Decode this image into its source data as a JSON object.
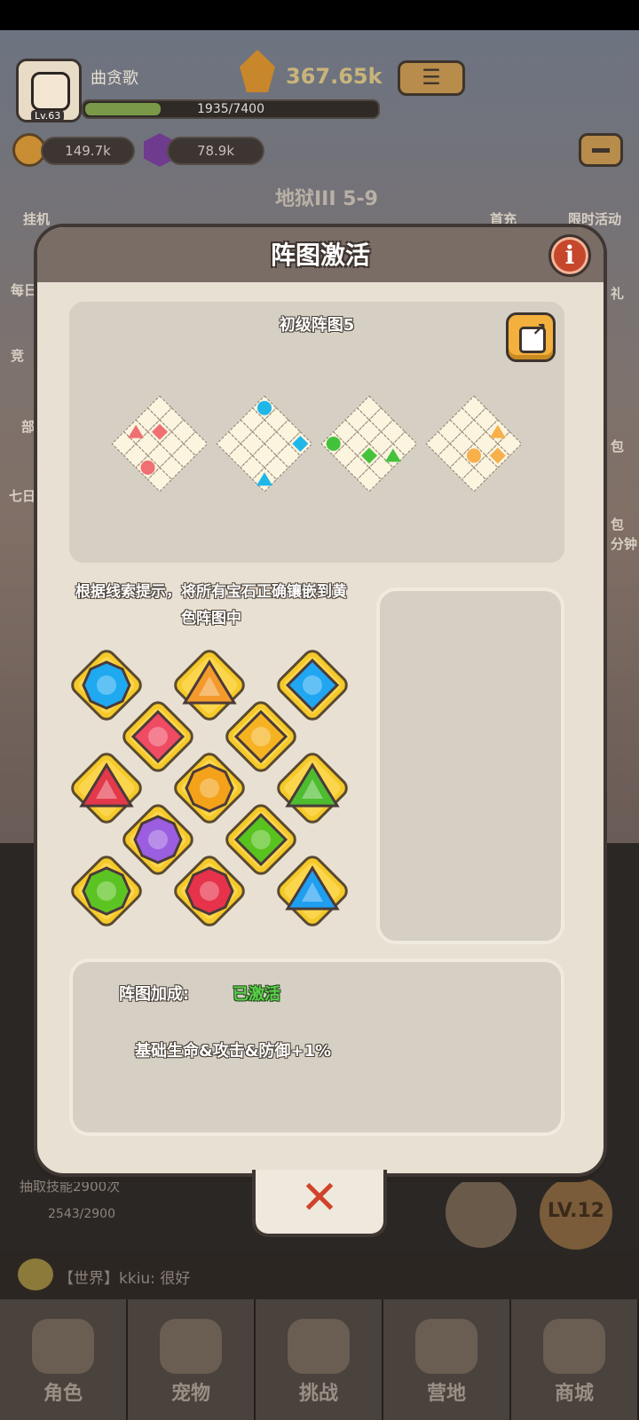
{
  "hud": {
    "player_name": "曲贪歌",
    "level": "Lv.63",
    "xp_text": "1935/7400",
    "xp_fraction": 0.26,
    "gem_count": "367.65k",
    "coins": "149.7k",
    "crystals": "78.9k",
    "stage": "地狱III 5-9",
    "side_left": [
      "挂机",
      "每日",
      "竞",
      "部",
      "七日"
    ],
    "side_right": [
      "首充",
      "限时活动",
      "礼",
      "包",
      "包",
      "分钟"
    ]
  },
  "modal": {
    "title": "阵图激活",
    "info_label": "i",
    "pattern_title": "初级阵图5",
    "hint": "根据线索提示，将所有宝石正确镶嵌到黄色阵图中",
    "bonus_label": "阵图加成:",
    "bonus_status": "已激活",
    "bonus_effect": "基础生命&攻击&防御+1%",
    "close_label": "✕"
  },
  "mini_boards": [
    {
      "color": "#ef6f72",
      "gems": [
        {
          "shape": "diamond",
          "r": 1,
          "c": 1
        },
        {
          "shape": "triangle",
          "r": 2,
          "c": 0
        },
        {
          "shape": "circle",
          "r": 3,
          "c": 2
        }
      ]
    },
    {
      "color": "#1fb7e8",
      "gems": [
        {
          "shape": "circle",
          "r": 0,
          "c": 0
        },
        {
          "shape": "diamond",
          "r": 0,
          "c": 3
        },
        {
          "shape": "triangle",
          "r": 3,
          "c": 3
        }
      ]
    },
    {
      "color": "#45c23c",
      "gems": [
        {
          "shape": "triangle",
          "r": 1,
          "c": 3
        },
        {
          "shape": "diamond",
          "r": 2,
          "c": 2
        },
        {
          "shape": "circle",
          "r": 3,
          "c": 0
        }
      ]
    },
    {
      "color": "#f7b04a",
      "gems": [
        {
          "shape": "triangle",
          "r": 0,
          "c": 2
        },
        {
          "shape": "diamond",
          "r": 1,
          "c": 3
        },
        {
          "shape": "circle",
          "r": 2,
          "c": 2
        }
      ]
    }
  ],
  "gem_grid": [
    {
      "row": 0,
      "col": 0,
      "shape": "circle",
      "color": "#1ea9f0"
    },
    {
      "row": 0,
      "col": 2,
      "shape": "triangle",
      "color": "#f39a2b"
    },
    {
      "row": 0,
      "col": 4,
      "shape": "diamond",
      "color": "#21a6f2"
    },
    {
      "row": 1,
      "col": 1,
      "shape": "diamond",
      "color": "#ef4b63"
    },
    {
      "row": 1,
      "col": 3,
      "shape": "diamond",
      "color": "#f5b322"
    },
    {
      "row": 2,
      "col": 0,
      "shape": "triangle",
      "color": "#e3394a"
    },
    {
      "row": 2,
      "col": 2,
      "shape": "circle",
      "color": "#f4a21a"
    },
    {
      "row": 2,
      "col": 4,
      "shape": "triangle",
      "color": "#4dbc2f"
    },
    {
      "row": 3,
      "col": 1,
      "shape": "circle",
      "color": "#9b5ee0"
    },
    {
      "row": 3,
      "col": 3,
      "shape": "diamond",
      "color": "#58c21e"
    },
    {
      "row": 4,
      "col": 0,
      "shape": "circle",
      "color": "#5cc422"
    },
    {
      "row": 4,
      "col": 2,
      "shape": "circle",
      "color": "#e6324a"
    },
    {
      "row": 4,
      "col": 4,
      "shape": "triangle",
      "color": "#1e9ff0"
    }
  ],
  "bottom": {
    "skill_text": "抽取技能2900次",
    "skill_progress": "2543/2900",
    "lv_badge": "LV.12",
    "chat": "【世界】kkiu: 很好"
  },
  "tabs": [
    {
      "label": "角色"
    },
    {
      "label": "宠物"
    },
    {
      "label": "挑战"
    },
    {
      "label": "营地"
    },
    {
      "label": "商城"
    }
  ]
}
